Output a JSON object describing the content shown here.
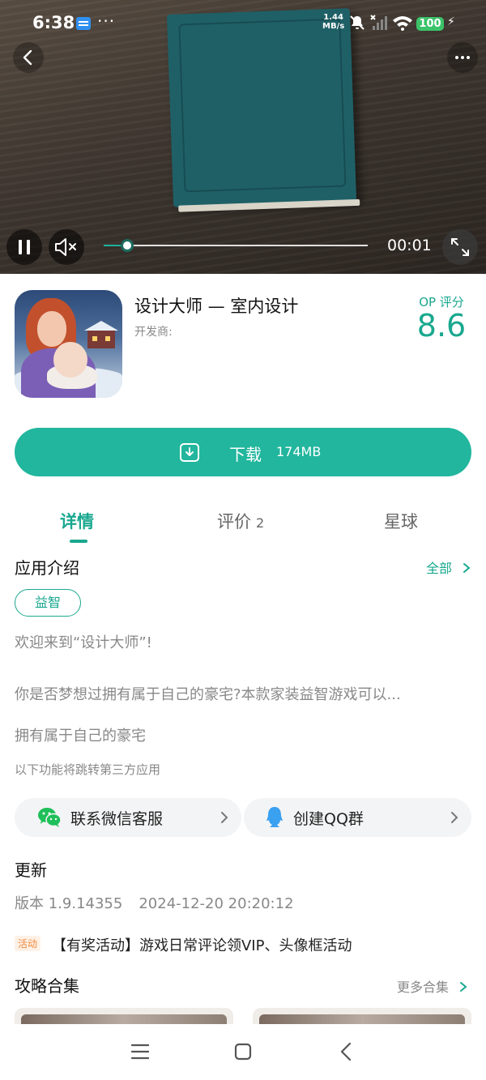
{
  "status_bar": {
    "time": "6:38",
    "dots": "···",
    "net_speed_value": "1.44",
    "net_speed_unit": "MB/s",
    "battery": "100",
    "battery_color": "#3cc36a"
  },
  "video": {
    "time": "00:01",
    "progress": 0.09,
    "controls": {
      "back_icon": "chevron-left-icon",
      "more_icon": "more-horizontal-icon",
      "pause_icon": "pause-icon",
      "mute_icon": "volume-muted-icon",
      "fullscreen_icon": "fullscreen-icon"
    }
  },
  "app": {
    "title": "设计大师 — 室内设计",
    "developer_label": "开发商:",
    "score_label": "OP 评分",
    "score": "8.6",
    "accent_color": "#21b69d"
  },
  "download": {
    "label": "下载",
    "size": "174MB"
  },
  "tabs": [
    {
      "label": "详情",
      "active": true
    },
    {
      "label": "评价",
      "count": "2",
      "active": false
    },
    {
      "label": "星球",
      "active": false
    }
  ],
  "intro": {
    "title": "应用介绍",
    "all_label": "全部",
    "tag": "益智",
    "lines": [
      "欢迎来到“设计大师”!",
      "你是否梦想过拥有属于自己的豪宅?本款家装益智游戏可以...",
      "拥有属于自己的豪宅"
    ],
    "third_party_note": "以下功能将跳转第三方应用"
  },
  "contacts": {
    "wechat": "联系微信客服",
    "qq": "创建QQ群"
  },
  "update": {
    "title": "更新",
    "version": "版本 1.9.14355",
    "date": "2024-12-20 20:20:12"
  },
  "activity": {
    "badge": "活动",
    "text": "【有奖活动】游戏日常评论领VIP、头像框活动"
  },
  "guides": {
    "title": "攻略合集",
    "more_label": "更多合集"
  }
}
